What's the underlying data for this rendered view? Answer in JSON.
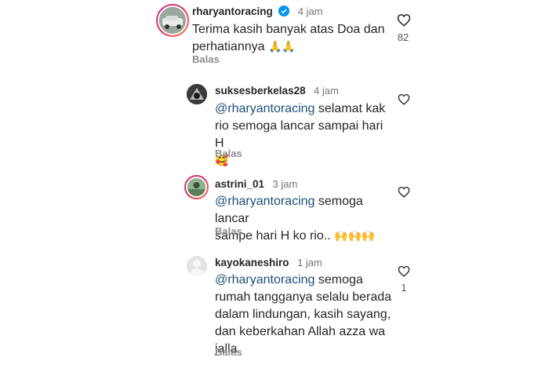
{
  "comments": [
    {
      "username": "rharyantoracing",
      "time": "4 jam",
      "text_line1": "Terima kasih banyak atas Doa dan",
      "text_line2": "perhatiannya",
      "emoji": "🙏🙏",
      "reply": "Balas",
      "likes": "82"
    },
    {
      "username": "suksesberkelas28",
      "time": "4 jam",
      "mention": "@rharyantoracing",
      "text_line1_rest": " selamat kak",
      "text_line2": "rio semoga lancar sampai hari H",
      "emoji": "🥰",
      "reply": "Balas"
    },
    {
      "username": "astrini_01",
      "time": "3 jam",
      "mention": "@rharyantoracing",
      "text_line1_rest": " semoga lancar",
      "text_line2": "sampe hari H ko rio..",
      "emoji": "🙌🙌🙌",
      "reply": "Balas"
    },
    {
      "username": "kayokaneshiro",
      "time": "1 jam",
      "mention": "@rharyantoracing",
      "text_line1_rest": " semoga",
      "text_line2": "rumah tangganya selalu berada",
      "text_line3": "dalam lindungan, kasih sayang,",
      "text_line4": "dan keberkahan Allah azza wa",
      "text_line5": "jalla",
      "reply": "Balas",
      "likes": "1"
    }
  ],
  "colors": {
    "mention": "#1d4f7a",
    "verified": "#0095f6",
    "secondary_text": "#8e8e8e"
  },
  "icons": [
    "verified-badge-icon",
    "heart-outline-icon",
    "default-avatar-icon"
  ]
}
